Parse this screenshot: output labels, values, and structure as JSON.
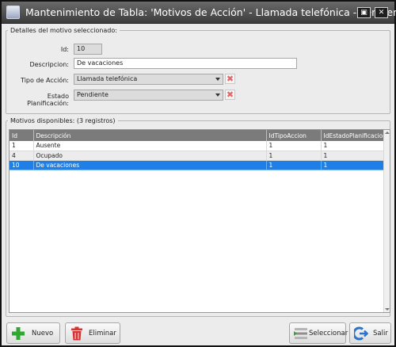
{
  "window": {
    "title": "Mantenimiento de Tabla: 'Motivos de Acción' - Llamada telefónica - Pendiente",
    "restore_glyph": "▣",
    "close_glyph": "✕"
  },
  "details": {
    "legend": "Detalles del motivo seleccionado:",
    "id_label": "Id:",
    "id_value": "10",
    "descripcion_label": "Descripcion:",
    "descripcion_value": "De vacaciones",
    "tipo_label": "Tipo de Acción:",
    "tipo_value": "Llamada telefónica",
    "estado_label": "Estado Planificación:",
    "estado_value": "Pendiente",
    "clear_glyph": "✖"
  },
  "list": {
    "legend": "Motivos disponibles: (3 registros)",
    "columns": [
      "Id",
      "Descripción",
      "IdTipoAccion",
      "IdEstadoPlanificacion"
    ],
    "rows": [
      [
        "1",
        "Ausente",
        "1",
        "1"
      ],
      [
        "4",
        "Ocupado",
        "1",
        "1"
      ],
      [
        "10",
        "De vacaciones",
        "1",
        "1"
      ]
    ],
    "selected_row": 2
  },
  "buttons": {
    "nuevo": "Nuevo",
    "eliminar": "Eliminar",
    "seleccionar": "Seleccionar",
    "salir": "Salir"
  },
  "icons": {
    "app": "app-window-icon",
    "nuevo": "plus-icon",
    "eliminar": "trash-icon",
    "seleccionar": "list-select-icon",
    "salir": "exit-icon"
  },
  "colors": {
    "selection": "#1e7fe6",
    "header": "#7b7b7b",
    "plus": "#2fa82f",
    "trash": "#d43434",
    "exit": "#2a74c9"
  }
}
